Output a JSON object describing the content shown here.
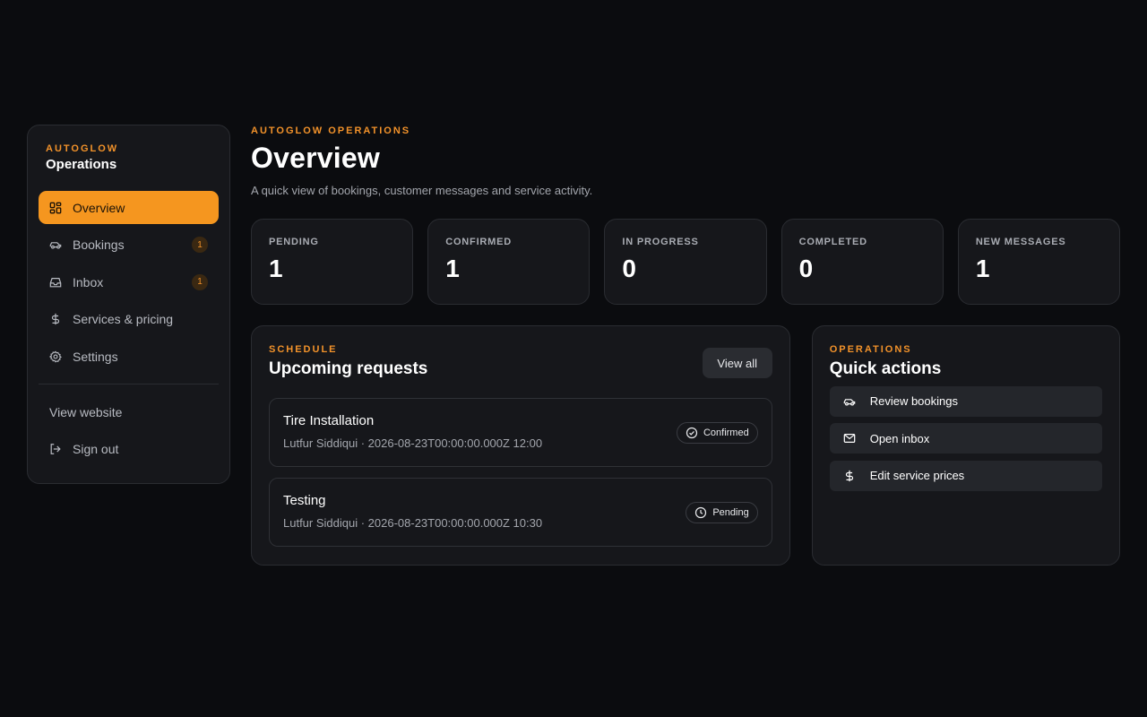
{
  "sidebar": {
    "brand_kicker": "AUTOGLOW",
    "brand_title": "Operations",
    "items": [
      {
        "label": "Overview",
        "icon": "grid-icon"
      },
      {
        "label": "Bookings",
        "icon": "car-icon",
        "badge": "1"
      },
      {
        "label": "Inbox",
        "icon": "inbox-icon",
        "badge": "1"
      },
      {
        "label": "Services & pricing",
        "icon": "dollar-icon"
      },
      {
        "label": "Settings",
        "icon": "gear-icon"
      }
    ],
    "view_website": "View website",
    "sign_out": "Sign out"
  },
  "header": {
    "kicker": "AUTOGLOW OPERATIONS",
    "title": "Overview",
    "subtitle": "A quick view of bookings, customer messages and service activity."
  },
  "stats": [
    {
      "label": "PENDING",
      "value": "1"
    },
    {
      "label": "CONFIRMED",
      "value": "1"
    },
    {
      "label": "IN PROGRESS",
      "value": "0"
    },
    {
      "label": "COMPLETED",
      "value": "0"
    },
    {
      "label": "NEW MESSAGES",
      "value": "1"
    }
  ],
  "schedule": {
    "kicker": "SCHEDULE",
    "title": "Upcoming requests",
    "view_all": "View all",
    "requests": [
      {
        "title": "Tire Installation",
        "meta": "Lutfur Siddiqui · 2026-08-23T00:00:00.000Z 12:00",
        "status": "Confirmed"
      },
      {
        "title": "Testing",
        "meta": "Lutfur Siddiqui · 2026-08-23T00:00:00.000Z 10:30",
        "status": "Pending"
      }
    ]
  },
  "actions": {
    "kicker": "OPERATIONS",
    "title": "Quick actions",
    "items": [
      {
        "label": "Review bookings",
        "icon": "car-icon"
      },
      {
        "label": "Open inbox",
        "icon": "mail-icon"
      },
      {
        "label": "Edit service prices",
        "icon": "dollar-icon"
      }
    ]
  },
  "colors": {
    "accent": "#f5961f",
    "background": "#0b0c0f",
    "card": "#16171b"
  }
}
